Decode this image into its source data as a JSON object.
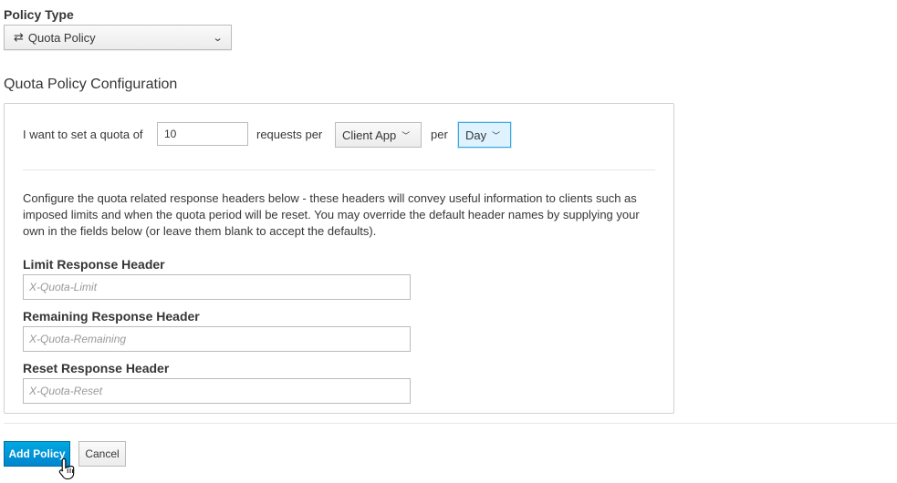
{
  "policy_type": {
    "label": "Policy Type",
    "selected": "Quota Policy",
    "icon": "exchange-icon"
  },
  "config": {
    "heading": "Quota Policy Configuration",
    "quota_prefix": "I want to set a quota of",
    "quota_value": "10",
    "requests_per_label": "requests per",
    "per_target": "Client App",
    "per_label": "per",
    "period": "Day",
    "help_text": "Configure the quota related response headers below - these headers will convey useful information to clients such as imposed limits and when the quota period will be reset. You may override the default header names by supplying your own in the fields below (or leave them blank to accept the defaults).",
    "fields": [
      {
        "label": "Limit Response Header",
        "value": "",
        "placeholder": "X-Quota-Limit"
      },
      {
        "label": "Remaining Response Header",
        "value": "",
        "placeholder": "X-Quota-Remaining"
      },
      {
        "label": "Reset Response Header",
        "value": "",
        "placeholder": "X-Quota-Reset"
      }
    ]
  },
  "actions": {
    "add_label": "Add Policy",
    "cancel_label": "Cancel"
  },
  "colors": {
    "primary": "#0088ce",
    "focus": "#39a5dc",
    "text": "#363636"
  }
}
